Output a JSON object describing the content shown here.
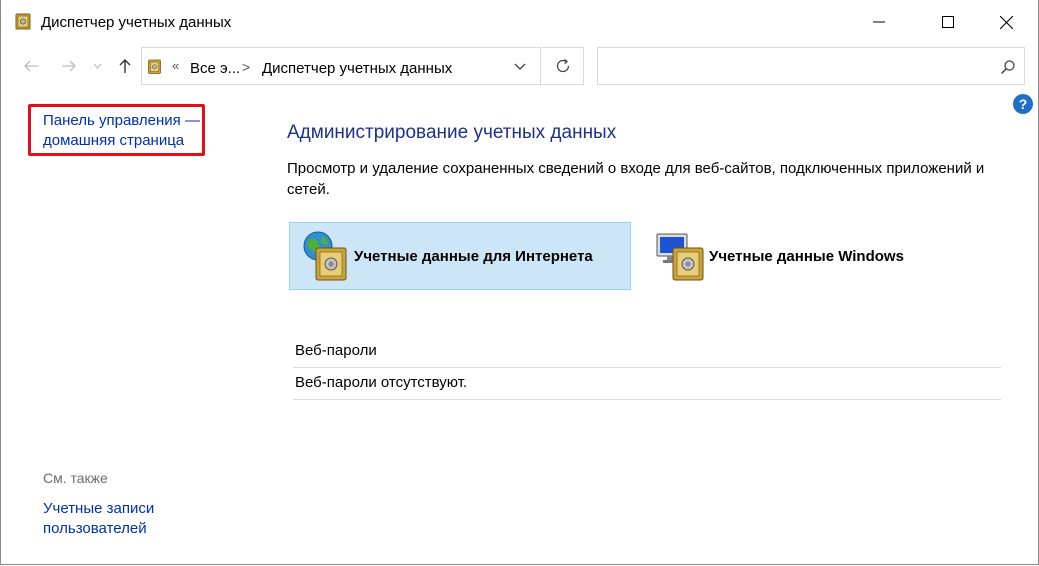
{
  "window": {
    "title": "Диспетчер учетных данных"
  },
  "navigation": {
    "breadcrumb_prefix": "«",
    "breadcrumb": [
      "Все э...",
      "Диспетчер учетных данных"
    ],
    "separator": ">",
    "search_placeholder": ""
  },
  "help": {
    "label": "?"
  },
  "left_pane": {
    "home_link_line1": "Панель управления —",
    "home_link_line2": "домашняя страница",
    "see_also_label": "См. также",
    "accounts_link_line1": "Учетные записи",
    "accounts_link_line2": "пользователей"
  },
  "main": {
    "title": "Администрирование учетных данных",
    "description_line1": "Просмотр и удаление сохраненных сведений о входе для веб-сайтов, подключенных приложений и",
    "description_line2": "сетей.",
    "tiles": [
      {
        "label": "Учетные данные для Интернета",
        "selected": true,
        "icon": "globe-vault-icon"
      },
      {
        "label": "Учетные данные Windows",
        "selected": false,
        "icon": "monitor-vault-icon"
      }
    ],
    "list_header": "Веб-пароли",
    "list_empty_text": "Веб-пароли отсутствуют."
  },
  "colors": {
    "link": "#002fb0",
    "heading": "#1e3287",
    "selected_tile_bg": "#cde6f7",
    "selected_tile_border": "#99d1f4",
    "highlight": "#e3101c",
    "help_icon": "#1f6fc4"
  }
}
